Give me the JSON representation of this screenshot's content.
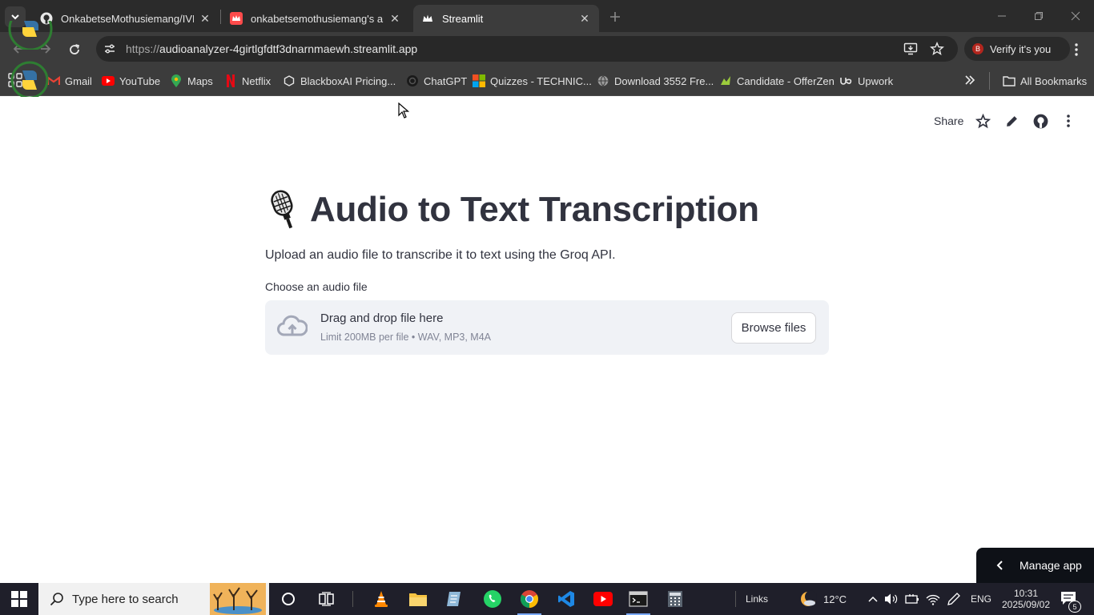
{
  "browser": {
    "tabs": [
      {
        "title": "OnkabetseMothusiemang/IVLE",
        "close": "✕"
      },
      {
        "title": "onkabetsemothusiemang's apps",
        "close": "✕"
      },
      {
        "title": "Streamlit",
        "close": "✕"
      }
    ],
    "url_protocol": "https://",
    "url_host": "audioanalyzer-4girtlgfdtf3dnarnmaewh.streamlit.app",
    "verify_label": "Verify it's you",
    "profile_initial": "B",
    "bookmarks": [
      {
        "label": "Gmail"
      },
      {
        "label": "YouTube"
      },
      {
        "label": "Maps"
      },
      {
        "label": "Netflix"
      },
      {
        "label": "BlackboxAI Pricing..."
      },
      {
        "label": "ChatGPT"
      },
      {
        "label": "Quizzes - TECHNIC..."
      },
      {
        "label": "Download 3552 Fre..."
      },
      {
        "label": "Candidate - OfferZen"
      },
      {
        "label": "Upwork"
      }
    ],
    "all_bookmarks": "All Bookmarks"
  },
  "app": {
    "share_label": "Share",
    "title": "Audio to Text Transcription",
    "title_icon": "microphone-icon",
    "subtitle": "Upload an audio file to transcribe it to text using the Groq API.",
    "uploader_label": "Choose an audio file",
    "drop_text": "Drag and drop file here",
    "limit_text": "Limit 200MB per file • WAV, MP3, M4A",
    "browse_label": "Browse files",
    "manage_label": "Manage app"
  },
  "taskbar": {
    "search_placeholder": "Type here to search",
    "links_label": "Links",
    "temperature": "12°C",
    "language": "ENG",
    "time": "10:31",
    "date": "2025/09/02",
    "notification_count": "5"
  },
  "colors": {
    "text": "#31333f",
    "dropzone_bg": "#f0f2f6",
    "manage_bg": "#0e1117",
    "chrome_dark": "#3c3c3c"
  }
}
